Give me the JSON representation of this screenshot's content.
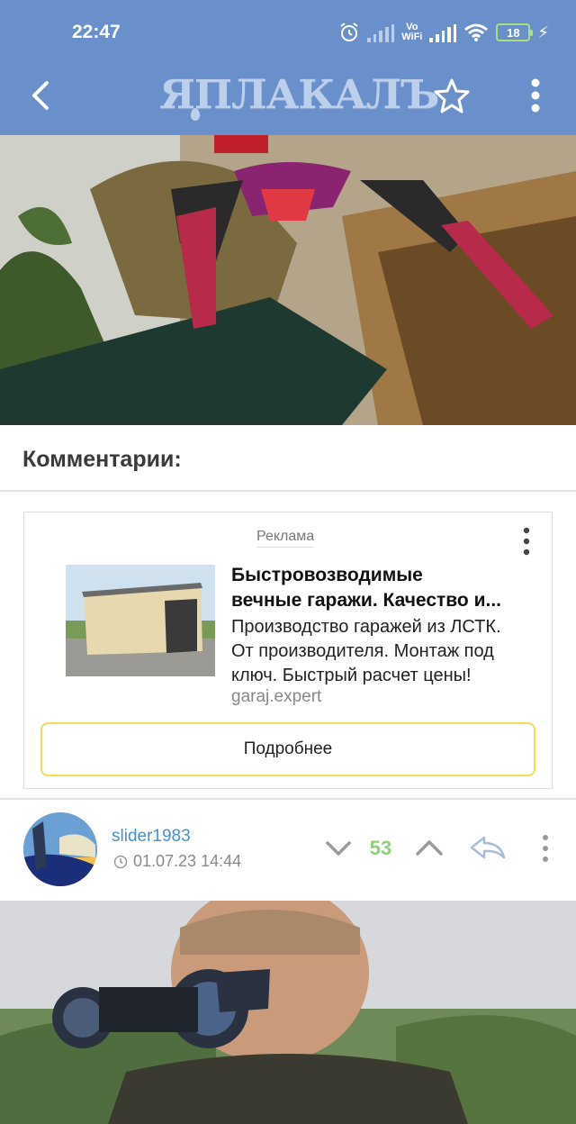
{
  "status_bar": {
    "time": "22:47",
    "vowifi_top": "Vo",
    "vowifi_bottom": "WiFi",
    "battery": "18",
    "icons": [
      "alarm-icon",
      "signal-icon",
      "vowifi-icon",
      "signal-icon",
      "wifi-icon",
      "battery-icon",
      "charging-icon"
    ]
  },
  "header": {
    "logo_text": "ЯПЛАКАЛЪ",
    "icons": [
      "back-arrow-icon",
      "star-icon",
      "more-vert-icon"
    ],
    "color": "#6a90cc"
  },
  "post": {
    "image_alt": "post-photo"
  },
  "comments": {
    "title": "Комментарии:"
  },
  "ad": {
    "label": "Реклама",
    "title_line1": "Быстровозводимые",
    "title_line2": "вечные гаражи. Качество и...",
    "desc_line1": "Производство гаражей из ЛСТК.",
    "desc_line2": "От производителя. Монтаж под",
    "desc_line3": "ключ. Быстрый расчет цены!",
    "domain": "garaj.expert",
    "button": "Подробнее",
    "button_border_color": "#f2dd55"
  },
  "comment": {
    "username": "slider1983",
    "timestamp": "01.07.23 14:44",
    "votes": "53",
    "vote_color": "#8fd07a",
    "username_color": "#4a90c8"
  }
}
